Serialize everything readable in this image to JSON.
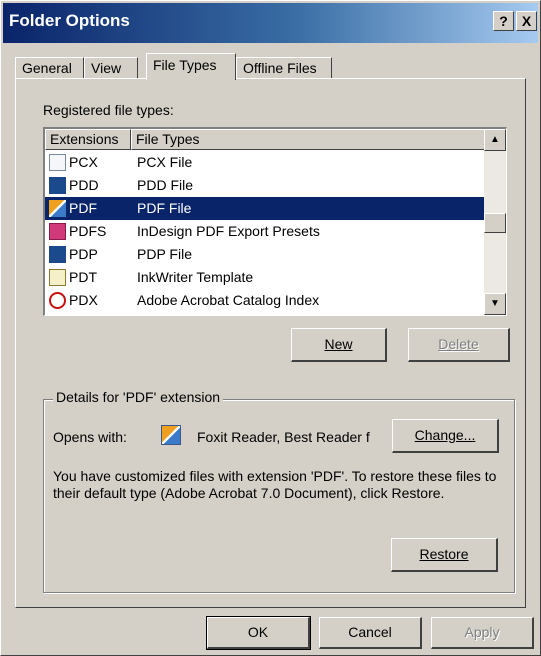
{
  "window": {
    "title": "Folder Options",
    "help_btn": "?",
    "close_btn": "X"
  },
  "tabs": [
    {
      "label": "General"
    },
    {
      "label": "View"
    },
    {
      "label": "File Types"
    },
    {
      "label": "Offline Files"
    }
  ],
  "registered_label": "Registered file types:",
  "list": {
    "headers": [
      "Extensions",
      "File Types"
    ],
    "rows": [
      {
        "ext": "PCX",
        "type": "PCX File",
        "icon": "pcx-file-icon"
      },
      {
        "ext": "PDD",
        "type": "PDD File",
        "icon": "photoshop-file-icon"
      },
      {
        "ext": "PDF",
        "type": "PDF File",
        "icon": "foxit-pdf-icon",
        "selected": true
      },
      {
        "ext": "PDFS",
        "type": "InDesign PDF Export Presets",
        "icon": "indesign-preset-icon"
      },
      {
        "ext": "PDP",
        "type": "PDP File",
        "icon": "photoshop-file-icon"
      },
      {
        "ext": "PDT",
        "type": "InkWriter Template",
        "icon": "template-file-icon"
      },
      {
        "ext": "PDX",
        "type": "Adobe Acrobat Catalog Index",
        "icon": "acrobat-search-icon"
      }
    ]
  },
  "buttons": {
    "new": "New",
    "delete": "Delete",
    "change": "Change...",
    "restore": "Restore",
    "ok": "OK",
    "cancel": "Cancel",
    "apply": "Apply"
  },
  "details": {
    "title": "Details for 'PDF' extension",
    "opens_with_label": "Opens with:",
    "opens_with_app": "Foxit Reader, Best Reader f",
    "description": "You have customized files with extension 'PDF'.  To restore these files to their default type (Adobe Acrobat 7.0 Document), click Restore."
  },
  "colors": {
    "selection": "#0a246a",
    "face": "#d4d0c8"
  }
}
